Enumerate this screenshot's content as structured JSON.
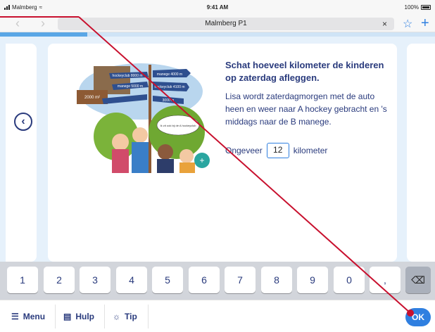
{
  "statusbar": {
    "carrier": "Malmberg",
    "time": "9:41 AM",
    "battery": "100%"
  },
  "browser": {
    "back_icon": "chevron-left-icon",
    "forward_icon": "chevron-right-icon",
    "url": "Malmberg P1",
    "clear": "×",
    "star_icon": "star-icon",
    "plus": "+"
  },
  "progress": {
    "fraction": 0.2
  },
  "navigation": {
    "back_label": "‹"
  },
  "illustration": {
    "sign_1": "manege 4000 m",
    "sign_2": "hockeyclub 8000 m",
    "sign_3": "manege 5000 m",
    "sign_4": "hockeyclub 4100 m",
    "sign_5": "3000 m",
    "area_sign": "2000 m²",
    "bubble": "Ik zit ook bij de A hockeyclub",
    "zoom": "+"
  },
  "question": {
    "title": "Schat hoeveel kilometer de kinderen op zaterdag afleggen.",
    "body": "Lisa wordt zaterdagmorgen met de auto heen en weer naar A hockey gebracht en 's middags naar de B manege.",
    "answer_prefix": "Ongeveer",
    "answer_value": "12",
    "answer_unit": "kilometer"
  },
  "keypad": {
    "keys": [
      "1",
      "2",
      "3",
      "4",
      "5",
      "6",
      "7",
      "8",
      "9",
      "0",
      ","
    ],
    "delete_icon": "backspace-icon"
  },
  "bottombar": {
    "menu": "Menu",
    "help": "Hulp",
    "tip": "Tip",
    "ok": "OK"
  },
  "colors": {
    "accent": "#2f7fe0",
    "text": "#2a3b7d",
    "annotation": "#c8102e"
  }
}
